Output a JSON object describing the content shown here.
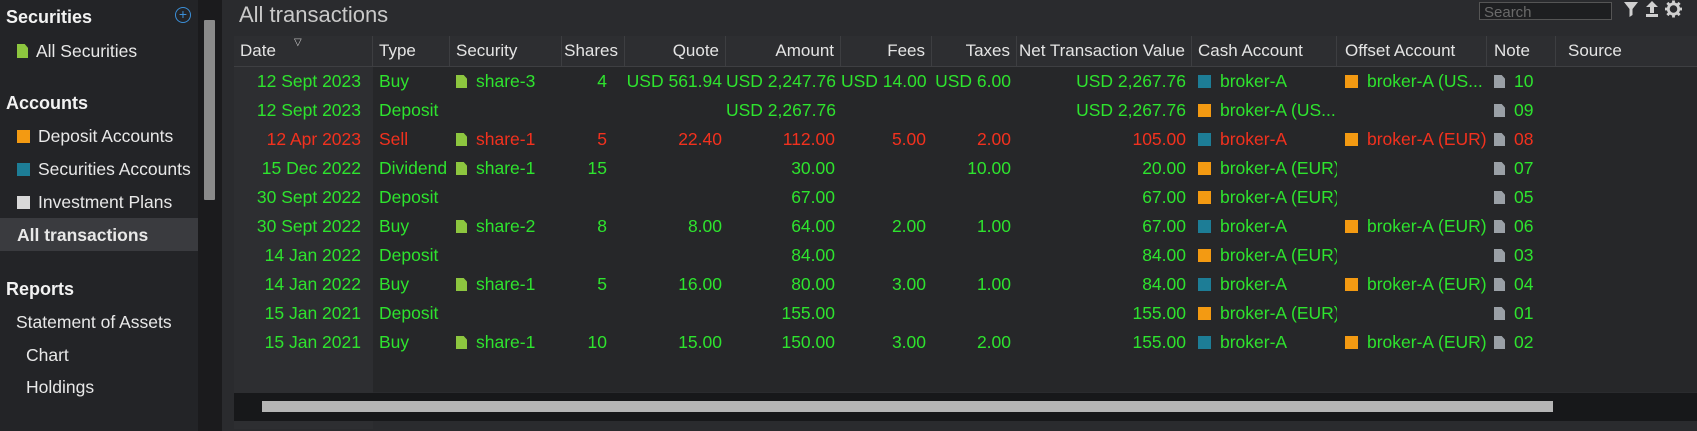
{
  "sidebar": {
    "securities_header": "Securities",
    "all_securities": "All Securities",
    "accounts_header": "Accounts",
    "deposit_accounts": "Deposit Accounts",
    "securities_accounts": "Securities Accounts",
    "investment_plans": "Investment Plans",
    "all_transactions": "All transactions",
    "reports_header": "Reports",
    "statement_of_assets": "Statement of Assets",
    "chart": "Chart",
    "holdings": "Holdings"
  },
  "main": {
    "title": "All transactions",
    "search_placeholder": "Search"
  },
  "columns": [
    "Date",
    "Type",
    "Security",
    "Shares",
    "Quote",
    "Amount",
    "Fees",
    "Taxes",
    "Net Transaction Value",
    "Cash Account",
    "Offset Account",
    "Note",
    "Source"
  ],
  "rows": [
    {
      "date": "12 Sept 2023",
      "type": "Buy",
      "security": "share-3",
      "shares": "4",
      "quote": "USD 561.94",
      "amount": "USD 2,247.76",
      "fees": "USD 14.00",
      "taxes": "USD 6.00",
      "net": "USD 2,267.76",
      "cash_account": "broker-A",
      "offset_account": "broker-A (US...",
      "note": "10",
      "color": "green"
    },
    {
      "date": "12 Sept 2023",
      "type": "Deposit",
      "security": "",
      "shares": "",
      "quote": "",
      "amount": "USD 2,267.76",
      "fees": "",
      "taxes": "",
      "net": "USD 2,267.76",
      "cash_account": "broker-A (US...",
      "offset_account": "",
      "note": "09",
      "color": "green"
    },
    {
      "date": "12 Apr 2023",
      "type": "Sell",
      "security": "share-1",
      "shares": "5",
      "quote": "22.40",
      "amount": "112.00",
      "fees": "5.00",
      "taxes": "2.00",
      "net": "105.00",
      "cash_account": "broker-A",
      "offset_account": "broker-A (EUR)",
      "note": "08",
      "color": "red"
    },
    {
      "date": "15 Dec 2022",
      "type": "Dividend",
      "security": "share-1",
      "shares": "15",
      "quote": "",
      "amount": "30.00",
      "fees": "",
      "taxes": "10.00",
      "net": "20.00",
      "cash_account": "broker-A (EUR)",
      "offset_account": "",
      "note": "07",
      "color": "green"
    },
    {
      "date": "30 Sept 2022",
      "type": "Deposit",
      "security": "",
      "shares": "",
      "quote": "",
      "amount": "67.00",
      "fees": "",
      "taxes": "",
      "net": "67.00",
      "cash_account": "broker-A (EUR)",
      "offset_account": "",
      "note": "05",
      "color": "green"
    },
    {
      "date": "30 Sept 2022",
      "type": "Buy",
      "security": "share-2",
      "shares": "8",
      "quote": "8.00",
      "amount": "64.00",
      "fees": "2.00",
      "taxes": "1.00",
      "net": "67.00",
      "cash_account": "broker-A",
      "offset_account": "broker-A (EUR)",
      "note": "06",
      "color": "green"
    },
    {
      "date": "14 Jan 2022",
      "type": "Deposit",
      "security": "",
      "shares": "",
      "quote": "",
      "amount": "84.00",
      "fees": "",
      "taxes": "",
      "net": "84.00",
      "cash_account": "broker-A (EUR)",
      "offset_account": "",
      "note": "03",
      "color": "green"
    },
    {
      "date": "14 Jan 2022",
      "type": "Buy",
      "security": "share-1",
      "shares": "5",
      "quote": "16.00",
      "amount": "80.00",
      "fees": "3.00",
      "taxes": "1.00",
      "net": "84.00",
      "cash_account": "broker-A",
      "offset_account": "broker-A (EUR)",
      "note": "04",
      "color": "green"
    },
    {
      "date": "15 Jan 2021",
      "type": "Deposit",
      "security": "",
      "shares": "",
      "quote": "",
      "amount": "155.00",
      "fees": "",
      "taxes": "",
      "net": "155.00",
      "cash_account": "broker-A (EUR)",
      "offset_account": "",
      "note": "01",
      "color": "green"
    },
    {
      "date": "15 Jan 2021",
      "type": "Buy",
      "security": "share-1",
      "shares": "10",
      "quote": "15.00",
      "amount": "150.00",
      "fees": "3.00",
      "taxes": "2.00",
      "net": "155.00",
      "cash_account": "broker-A",
      "offset_account": "broker-A (EUR)",
      "note": "02",
      "color": "green"
    }
  ],
  "colors": {
    "green": "#2ee32e",
    "red": "#f2311e",
    "securities_account": "#1d7d96",
    "deposit_account": "#f39a12",
    "security_doc": "#8dc63f"
  },
  "icons": {
    "add": "plus-circle-icon",
    "filter": "filter-icon",
    "export": "export-icon",
    "settings": "gear-icon",
    "security": "document-icon",
    "note": "note-icon",
    "sort": "sort-descending-icon"
  }
}
